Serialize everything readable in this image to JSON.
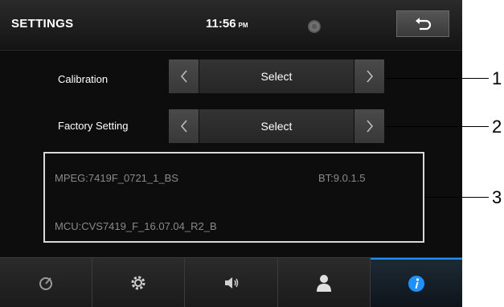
{
  "header": {
    "title": "SETTINGS",
    "time": "11:56",
    "ampm": "PM",
    "disc_icon": "disc-icon",
    "back_icon": "back-arrow-icon"
  },
  "settings": [
    {
      "label": "Calibration",
      "value": "Select"
    },
    {
      "label": "Factory Setting",
      "value": "Select"
    }
  ],
  "info": {
    "mpeg": "MPEG:7419F_0721_1_BS",
    "bt": "BT:9.0.1.5",
    "mcu": "MCU:CVS7419_F_16.07.04_R2_B"
  },
  "nav": [
    {
      "icon": "dial-icon",
      "active": false
    },
    {
      "icon": "gear-icon",
      "active": false
    },
    {
      "icon": "speaker-icon",
      "active": false
    },
    {
      "icon": "user-icon",
      "active": false
    },
    {
      "icon": "info-icon",
      "active": true
    }
  ],
  "callouts": [
    "1",
    "2",
    "3"
  ],
  "colors": {
    "accent": "#1e90ff",
    "background": "#0d0d0d",
    "text": "#ffffff",
    "info_text": "#8a8a8a"
  }
}
